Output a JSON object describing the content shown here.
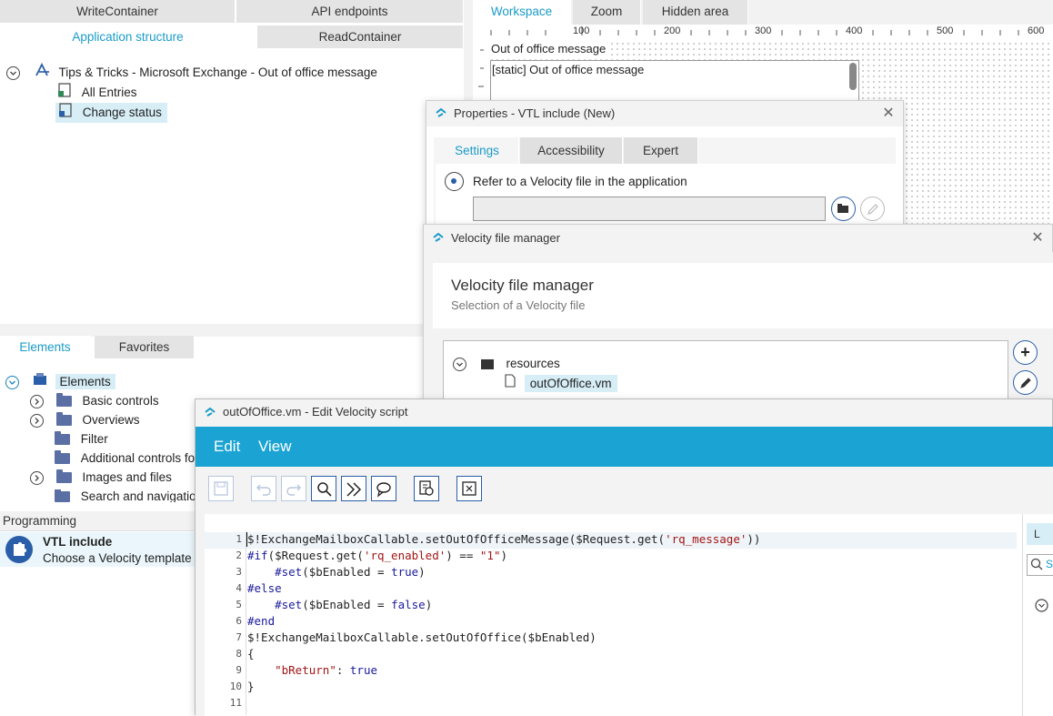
{
  "top_tabs": {
    "row1": [
      "WriteContainer",
      "API endpoints"
    ],
    "row2": [
      "Application structure",
      "ReadContainer"
    ]
  },
  "app_tree": {
    "root": "Tips & Tricks - Microsoft Exchange - Out of office message",
    "children": [
      "All Entries",
      "Change status"
    ]
  },
  "workspace_tabs": [
    "Workspace",
    "Zoom",
    "Hidden area"
  ],
  "ruler": [
    "100",
    "200",
    "300",
    "400",
    "500",
    "600"
  ],
  "canvas": {
    "label": "Out of office message",
    "textarea_value": "[static] Out of office message"
  },
  "elements_panel": {
    "tabs": [
      "Elements",
      "Favorites"
    ],
    "root": "Elements",
    "items": [
      "Basic controls",
      "Overviews",
      "Filter",
      "Additional controls fo",
      "Images and files",
      "Search and navigatio"
    ]
  },
  "programming": {
    "header": "Programming",
    "item_title": "VTL include",
    "item_desc": "Choose a Velocity template t"
  },
  "properties_window": {
    "title": "Properties - VTL include (New)",
    "tabs": [
      "Settings",
      "Accessibility",
      "Expert"
    ],
    "radio_label": "Refer to a Velocity file in the application",
    "file_value": ""
  },
  "vfm_window": {
    "title": "Velocity file manager",
    "heading": "Velocity file manager",
    "subheading": "Selection of a Velocity file",
    "folder": "resources",
    "file": "outOfOffice.vm"
  },
  "editor_window": {
    "title": "outOfOffice.vm - Edit Velocity script",
    "menu": [
      "Edit",
      "View"
    ],
    "right_panel_label": "L",
    "right_search_placeholder": "S"
  },
  "code_lines": [
    "1",
    "2",
    "3",
    "4",
    "5",
    "6",
    "7",
    "8",
    "9",
    "10",
    "11"
  ],
  "colors": {
    "accent": "#1a9bc8",
    "menubar": "#1aa3d3",
    "selection": "#d7eef7",
    "icon_blue": "#2b5ea8"
  }
}
